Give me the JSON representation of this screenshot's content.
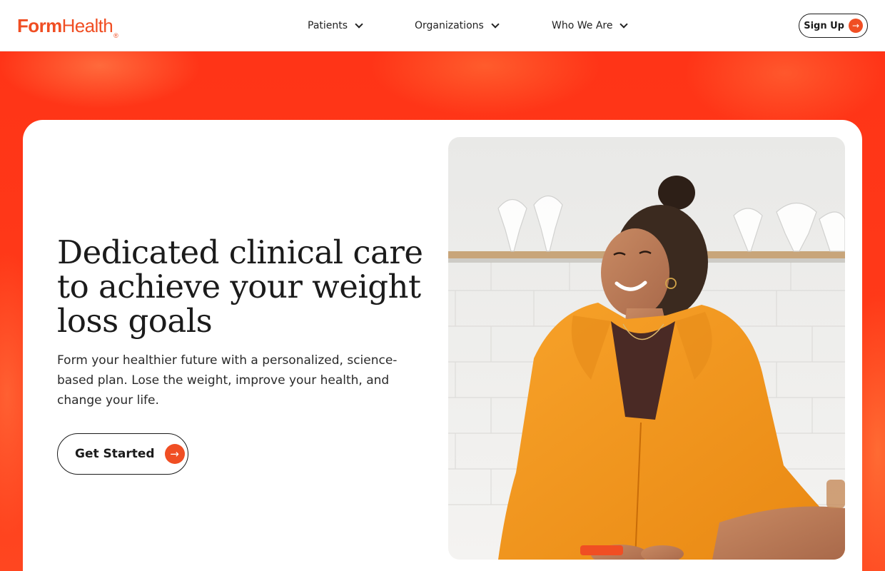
{
  "brand": {
    "logo_form": "Form",
    "logo_health": "Health",
    "logo_reg": "®",
    "accent": "#f04e23",
    "hero_bg": "#ff3a1a"
  },
  "nav": {
    "items": [
      {
        "label": "Patients",
        "icon": "chevron-down-icon"
      },
      {
        "label": "Organizations",
        "icon": "chevron-down-icon"
      },
      {
        "label": "Who We Are",
        "icon": "chevron-down-icon"
      }
    ],
    "signup_label": "Sign Up",
    "signup_icon": "arrow-right-icon"
  },
  "hero": {
    "headline": "Dedicated clinical care to achieve your weight loss goals",
    "subtext": "Form your healthier future with a personalized, science-based plan. Lose the weight, improve your health, and change your life.",
    "cta_label": "Get Started",
    "cta_icon": "arrow-right-icon",
    "image": "smiling-woman-orange-hoodie-kitchen"
  }
}
